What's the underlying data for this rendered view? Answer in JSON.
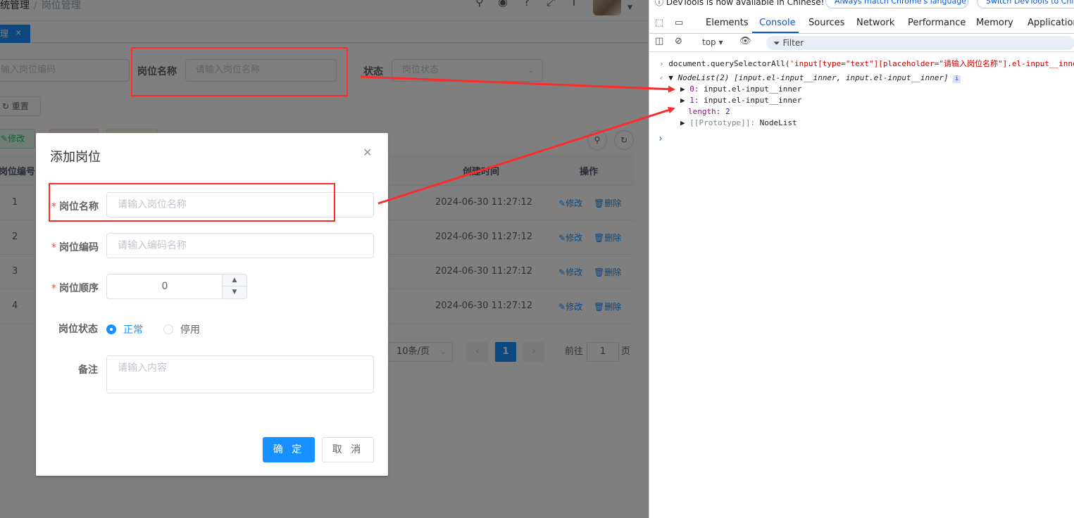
{
  "app": {
    "breadcrumb": [
      "系统管理",
      "岗位管理"
    ],
    "tag_label": "理",
    "query": {
      "code_placeholder": "输入岗位编码",
      "name_label": "岗位名称",
      "name_placeholder": "请输入岗位名称",
      "status_label": "状态",
      "status_placeholder": "岗位状态",
      "reset_label": "重置"
    },
    "toolbar": {
      "edit_label": "修改"
    },
    "table": {
      "columns": [
        "岗位编号",
        "创建时间",
        "操作"
      ],
      "rows": [
        {
          "id": "1",
          "created": "2024-06-30 11:27:12"
        },
        {
          "id": "2",
          "created": "2024-06-30 11:27:12"
        },
        {
          "id": "3",
          "created": "2024-06-30 11:27:12"
        },
        {
          "id": "4",
          "created": "2024-06-30 11:27:12"
        }
      ],
      "edit_action": "修改",
      "delete_action": "删除"
    },
    "pagination": {
      "page_size": "10条/页",
      "current_page": "1",
      "goto_label": "前往",
      "goto_value": "1",
      "page_suffix": "页"
    },
    "dialog": {
      "title": "添加岗位",
      "fields": {
        "name_label": "岗位名称",
        "name_placeholder": "请输入岗位名称",
        "code_label": "岗位编码",
        "code_placeholder": "请输入编码名称",
        "order_label": "岗位顺序",
        "order_value": "0",
        "status_label": "岗位状态",
        "status_normal": "正常",
        "status_disabled": "停用",
        "remark_label": "备注",
        "remark_placeholder": "请输入内容"
      },
      "confirm_label": "确 定",
      "cancel_label": "取 消"
    }
  },
  "devtools": {
    "banner_text": "DevTools is now available in Chinese!",
    "banner_btn1": "Always match Chrome's language",
    "banner_btn2": "Switch DevTools to Chinese",
    "tabs": [
      "Elements",
      "Console",
      "Sources",
      "Network",
      "Performance",
      "Memory",
      "Application"
    ],
    "active_tab": "Console",
    "context": "top",
    "filter_placeholder": "Filter",
    "console": {
      "cmd_prefix": "document.querySelectorAll(",
      "cmd_arg": "'input[type=\"text\"][placeholder=\"请输入岗位名称\"].el-input__inner'",
      "cmd_suffix": ")",
      "result_head": "NodeList(2)",
      "result_preview": "[input.el-input__inner, input.el-input__inner]",
      "item0_key": "0",
      "item0_val": "input.el-input__inner",
      "item1_key": "1",
      "item1_val": "input.el-input__inner",
      "length_key": "length",
      "length_val": "2",
      "proto_key": "[[Prototype]]",
      "proto_val": "NodeList"
    }
  },
  "colors": {
    "primary": "#1890ff",
    "annotation": "#ff2b2b",
    "devtools_accent": "#0b57d0"
  }
}
